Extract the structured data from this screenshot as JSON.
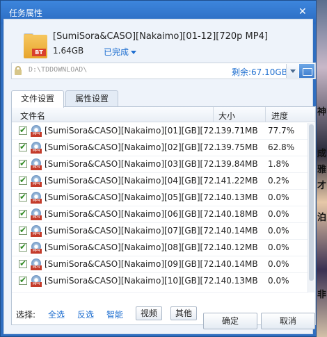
{
  "window": {
    "title": "任务属性"
  },
  "task": {
    "name": "[SumiSora&CASO][Nakaimo][01-12][720p MP4]",
    "size": "1.64GB",
    "status": "已完成",
    "icon_badge": "BT"
  },
  "path": {
    "value": "D:\\TDDOWNLOAD\\",
    "remaining": "剩余:67.10GB"
  },
  "tabs": [
    {
      "label": "文件设置",
      "active": true
    },
    {
      "label": "属性设置",
      "active": false
    }
  ],
  "table": {
    "headers": {
      "name": "文件名",
      "size": "大小",
      "progress": "进度"
    },
    "rows": [
      {
        "name": "[SumiSora&CASO][Nakaimo][01][GB][72...",
        "size": "139.71MB",
        "progress": "77.7%",
        "checked": true
      },
      {
        "name": "[SumiSora&CASO][Nakaimo][02][GB][72...",
        "size": "139.75MB",
        "progress": "62.8%",
        "checked": true
      },
      {
        "name": "[SumiSora&CASO][Nakaimo][03][GB][72...",
        "size": "139.84MB",
        "progress": "1.8%",
        "checked": true
      },
      {
        "name": "[SumiSora&CASO][Nakaimo][04][GB][72...",
        "size": "141.22MB",
        "progress": "0.2%",
        "checked": true
      },
      {
        "name": "[SumiSora&CASO][Nakaimo][05][GB][72...",
        "size": "140.13MB",
        "progress": "0.0%",
        "checked": true
      },
      {
        "name": "[SumiSora&CASO][Nakaimo][06][GB][72...",
        "size": "140.18MB",
        "progress": "0.0%",
        "checked": true
      },
      {
        "name": "[SumiSora&CASO][Nakaimo][07][GB][72...",
        "size": "140.14MB",
        "progress": "0.0%",
        "checked": true
      },
      {
        "name": "[SumiSora&CASO][Nakaimo][08][GB][72...",
        "size": "140.12MB",
        "progress": "0.0%",
        "checked": true
      },
      {
        "name": "[SumiSora&CASO][Nakaimo][09][GB][72...",
        "size": "140.14MB",
        "progress": "0.0%",
        "checked": true
      },
      {
        "name": "[SumiSora&CASO][Nakaimo][10][GB][72...",
        "size": "140.13MB",
        "progress": "0.0%",
        "checked": true
      }
    ]
  },
  "selection": {
    "label": "选择:",
    "select_all": "全选",
    "invert": "反选",
    "smart": "智能",
    "video": "视频",
    "other": "其他"
  },
  "buttons": {
    "ok": "确定",
    "cancel": "取消"
  },
  "background_chars": [
    "神",
    "成",
    "雅",
    "才",
    "泊",
    "非"
  ],
  "colors": {
    "link": "#1f6fd0",
    "titlebar": "#2f6ec0",
    "checkmark": "#2f8a22"
  }
}
